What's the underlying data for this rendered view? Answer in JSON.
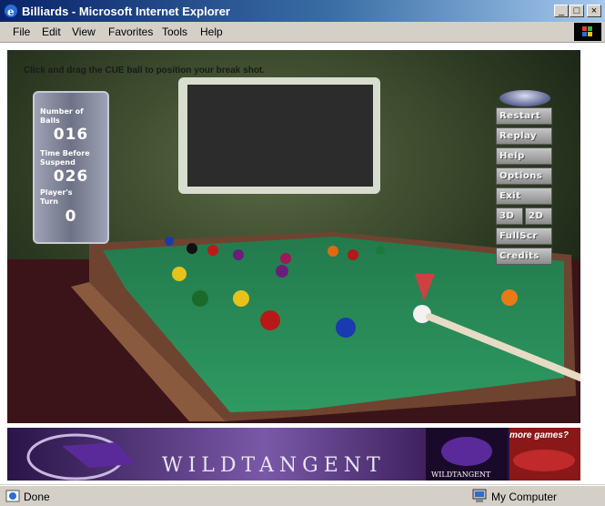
{
  "window": {
    "title": "Billiards - Microsoft Internet Explorer"
  },
  "menu": [
    "File",
    "Edit",
    "View",
    "Favorites",
    "Tools",
    "Help"
  ],
  "game": {
    "instruction": "Click and drag the CUE ball to position your break shot.",
    "hud": {
      "balls_label": "Number of\nBalls",
      "balls_value": "016",
      "time_label": "Time Before\nSuspend",
      "time_value": "026",
      "turn_label": "Player's\nTurn",
      "turn_value": "0"
    },
    "buttons": {
      "restart": "Restart",
      "replay": "Replay",
      "help": "Help",
      "options": "Options",
      "exit": "Exit",
      "view_3d": "3D",
      "view_2d": "2D",
      "fullscreen": "FullScr",
      "credits": "Credits"
    }
  },
  "banner": {
    "brand": "WILDTANGENT",
    "logo_text": "WILDTANGENT",
    "more_games": "more games?"
  },
  "status": {
    "text": "Done",
    "zone": "My Computer"
  },
  "colors": {
    "felt": "#2a8a5a",
    "title_start": "#0a246a"
  }
}
